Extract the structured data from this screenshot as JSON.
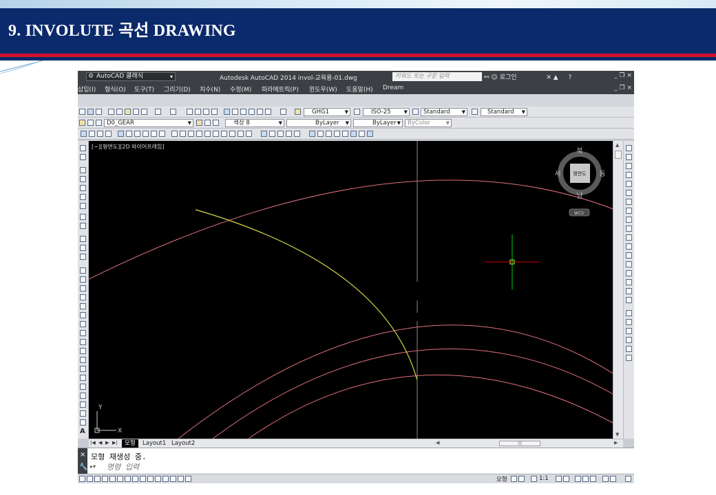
{
  "slide": {
    "title": "9.   INVOLUTE 곡선 DRAWING"
  },
  "titlebar": {
    "workspace": "AutoCAD 클래식",
    "app_title": "Autodesk AutoCAD 2014     invol-교육용-01.dwg",
    "search_placeholder": "키워드 또는 구문 입력",
    "login": "로그인"
  },
  "menu": {
    "items": [
      "삽입(I)",
      "형식(O)",
      "도구(T)",
      "그리기(D)",
      "치수(N)",
      "수정(M)",
      "파라메트릭(P)",
      "윈도우(W)",
      "도움말(H)",
      "Dream"
    ]
  },
  "styles_toolbar": {
    "text_style": "GHG1",
    "dim_style": "ISO-25",
    "table_style": "Standard",
    "mleader_style": "Standard"
  },
  "layers_toolbar": {
    "layer": "D0_GEAR",
    "color": "색상 8",
    "linetype": "ByLayer",
    "lineweight": "ByLayer",
    "plotstyle": "ByColor"
  },
  "viewport": {
    "label": "[−][평면도][2D 와이어프레임]",
    "viewcube": {
      "north": "북",
      "south": "남",
      "east": "동",
      "west": "서",
      "face": "평면도",
      "wcs": "WCS"
    },
    "ucs": {
      "x": "X",
      "y": "Y"
    }
  },
  "layout_tabs": [
    "모형",
    "Layout1",
    "Layout2"
  ],
  "command": {
    "history": "모형 재생성 중.",
    "placeholder": "명령 입력"
  },
  "statusbar": {
    "model_label": "모형",
    "scale": "1:1"
  },
  "colors": {
    "header_blue": "#0b2a6b",
    "header_red": "#d4122a",
    "circle_red": "#e0707e",
    "involute_yellow": "#d8d84a",
    "crosshair_green": "#00d000",
    "crosshair_red": "#d00000"
  }
}
